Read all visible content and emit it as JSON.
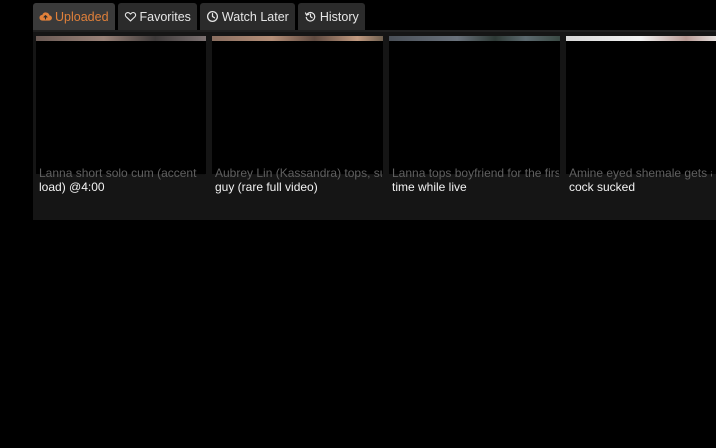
{
  "tabs": [
    {
      "label": "Uploaded",
      "icon": "cloud-upload-icon",
      "active": true
    },
    {
      "label": "Favorites",
      "icon": "heart-icon",
      "active": false
    },
    {
      "label": "Watch Later",
      "icon": "clock-icon",
      "active": false
    },
    {
      "label": "History",
      "icon": "history-icon",
      "active": false
    }
  ],
  "videos": [
    {
      "title_line1": "Lanna short solo cum (accent",
      "title_line2": "load) @4:00"
    },
    {
      "title_line1": "Aubrey Lin (Kassandra) tops, sucks",
      "title_line2": "guy (rare full video)"
    },
    {
      "title_line1": "Lanna tops boyfriend for the first",
      "title_line2": "time while live"
    },
    {
      "title_line1": "Amine eyed shemale gets anal",
      "title_line2": "cock sucked"
    }
  ],
  "colors": {
    "accent": "#e0803a",
    "tab_bg": "#2b2b2b",
    "card_bg": "#151515",
    "page_bg": "#000000"
  }
}
